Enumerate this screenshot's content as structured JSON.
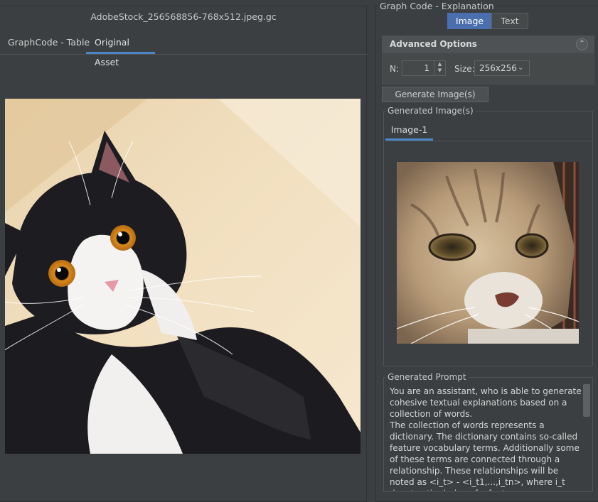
{
  "left": {
    "file_title": "AdobeStock_256568856-768x512.jpeg.gc",
    "tabs": [
      "GraphCode - Table",
      "Original Asset"
    ],
    "active_tab": "Original Asset",
    "original_image_alt": "Photo of a black and white cat looking up"
  },
  "right": {
    "section_title": "Graph Code - Explanation",
    "mode_toggle": [
      "Image",
      "Text"
    ],
    "active_mode": "Image",
    "advanced": {
      "title": "Advanced Options",
      "n_label": "N:",
      "n_value": "1",
      "size_label": "Size:",
      "size_value": "256x256"
    },
    "generate_button": "Generate Image(s)",
    "generated_images": {
      "legend": "Generated Image(s)",
      "tabs": [
        "Image-1"
      ],
      "image_alt": "Generated image of a tabby cat face"
    },
    "generated_prompt": {
      "legend": "Generated Prompt",
      "text": "You are an assistant, who is able to generate cohesive textual explanations based on a collection of words.\nThe collection of words represents a dictionary. The dictionary contains so-called feature vocabulary terms. Additionally some of these terms are connected through a relationship. These relationships will be noted as <i_t> - <i_t1,...,i_tn>, where i_t denotes the index of a feature"
    }
  },
  "colors": {
    "background": "#3c3f41",
    "accent": "#4a88c7",
    "toggle_active": "#4b6eaf"
  }
}
